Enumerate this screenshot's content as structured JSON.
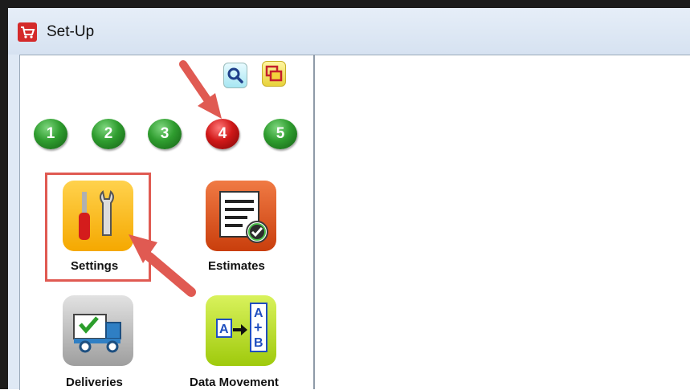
{
  "window": {
    "title": "Set-Up"
  },
  "steps": [
    "1",
    "2",
    "3",
    "4",
    "5"
  ],
  "active_step": "4",
  "tiles": {
    "settings": {
      "label": "Settings"
    },
    "estimates": {
      "label": "Estimates"
    },
    "deliveries": {
      "label": "Deliveries"
    },
    "data_movement": {
      "label": "Data Movement"
    }
  },
  "colors": {
    "step_active": "#d01818",
    "step_inactive": "#2f9d2f",
    "annotation_arrow": "#e05a52"
  },
  "icons": [
    "cart-icon",
    "magnifier-icon",
    "windows-icon",
    "tools-icon",
    "checklist-icon",
    "truck-icon",
    "a-to-b-icon"
  ]
}
